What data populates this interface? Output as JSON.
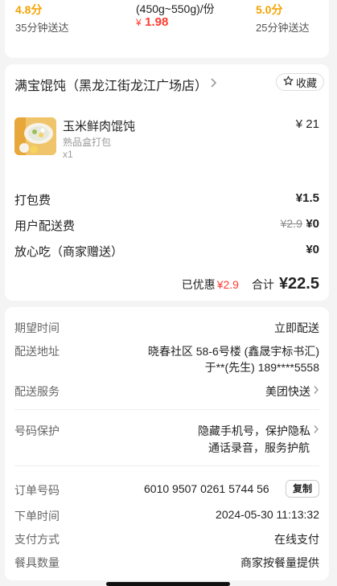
{
  "top_options": {
    "left": {
      "rating": "4.8分",
      "time": "35分钟送达"
    },
    "middle": {
      "spec": "(450g~550g)/份",
      "currency": "¥",
      "price": "1.98"
    },
    "right": {
      "rating": "5.0分",
      "time": "25分钟送达"
    }
  },
  "store": {
    "name": "满宝馄饨（黑龙江街龙江广场店）",
    "favorite_label": "收藏"
  },
  "item": {
    "name": "玉米鲜肉馄饨",
    "pack": "熟品盒打包",
    "qty": "x1",
    "price": "¥ 21"
  },
  "fees": {
    "packing_label": "打包费",
    "packing_value": "¥1.5",
    "delivery_label": "用户配送费",
    "delivery_original": "¥2.9",
    "delivery_value": "¥0",
    "insurance_label": "放心吃（商家赠送）",
    "insurance_value": "¥0"
  },
  "summary": {
    "discount_label": "已优惠",
    "discount_value": "¥2.9",
    "total_label": "合计",
    "total_value": "¥22.5"
  },
  "order_info": {
    "expected_time_label": "期望时间",
    "expected_time_value": "立即配送",
    "address_label": "配送地址",
    "address_line1": "晓春社区 58-6号楼 (鑫晟宇标书汇)",
    "address_line2": "于**(先生) 189****5558",
    "service_label": "配送服务",
    "service_value": "美团快送",
    "privacy_label": "号码保护",
    "privacy_line1": "隐藏手机号，保护隐私",
    "privacy_line2": "通话录音，服务护航",
    "order_no_label": "订单号码",
    "order_no_value": "6010 9507 0261 5744 56",
    "copy_label": "复制",
    "order_time_label": "下单时间",
    "order_time_value": "2024-05-30 11:13:32",
    "payment_label": "支付方式",
    "payment_value": "在线支付",
    "utensils_label": "餐具数量",
    "utensils_value": "商家按餐量提供"
  },
  "colors": {
    "accent_red": "#ff3b30",
    "rating_orange": "#f5a300"
  }
}
